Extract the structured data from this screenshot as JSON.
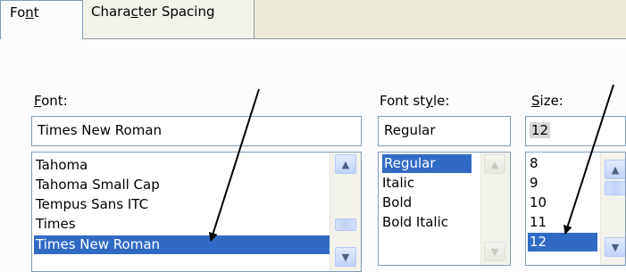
{
  "tabs": [
    {
      "label_pre": "Fo",
      "label_u": "n",
      "label_post": "t"
    },
    {
      "label_pre": "Chara",
      "label_u": "c",
      "label_post": "ter Spacing"
    }
  ],
  "font": {
    "label_pre": "",
    "label_u": "F",
    "label_post": "ont:",
    "value": "Times New Roman",
    "items": [
      "Tahoma",
      "Tahoma Small Cap",
      "Tempus Sans ITC",
      "Times",
      "Times New Roman"
    ],
    "selected": "Times New Roman"
  },
  "style": {
    "label_pre": "Font st",
    "label_u": "y",
    "label_post": "le:",
    "value": "Regular",
    "items": [
      "Regular",
      "Italic",
      "Bold",
      "Bold Italic"
    ],
    "selected": "Regular"
  },
  "size": {
    "label_pre": "",
    "label_u": "S",
    "label_post": "ize:",
    "value": "12",
    "items": [
      "8",
      "9",
      "10",
      "11",
      "12"
    ],
    "selected": "12"
  },
  "colors": {
    "selection": "#316ac5",
    "border": "#7f9db9",
    "arrow": "#000000"
  },
  "icons": {
    "scroll_up": "chevron-up-icon",
    "scroll_down": "chevron-down-icon",
    "annotation_arrow": "arrow-icon"
  }
}
